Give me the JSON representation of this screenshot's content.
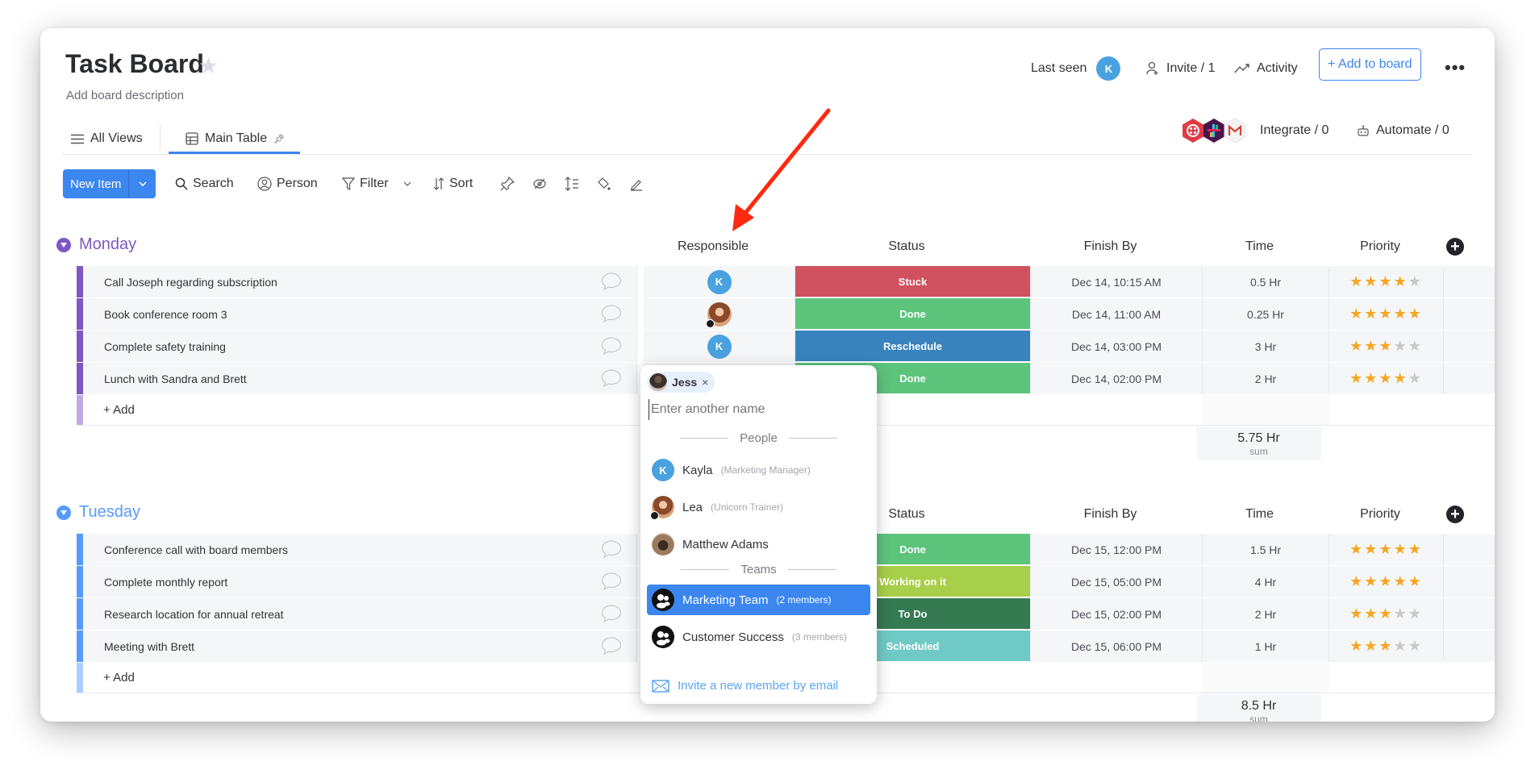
{
  "board": {
    "title": "Task Board",
    "description": "Add board description"
  },
  "header": {
    "last_seen_label": "Last seen",
    "last_seen_avatar": "K",
    "invite_label": "Invite / 1",
    "activity_label": "Activity",
    "add_to_board_label": "+ Add to board",
    "integrate_label": "Integrate / 0",
    "automate_label": "Automate / 0"
  },
  "tabs": [
    {
      "label": "All Views",
      "icon": "menu-icon"
    },
    {
      "label": "Main Table",
      "icon": "table-icon",
      "active": true
    }
  ],
  "toolbar": {
    "new_item_label": "New Item",
    "search_label": "Search",
    "person_label": "Person",
    "filter_label": "Filter",
    "sort_label": "Sort"
  },
  "columns": [
    "Responsible",
    "Status",
    "Finish By",
    "Time",
    "Priority"
  ],
  "groups": [
    {
      "name": "Monday",
      "color": "#7e57c2",
      "add_label": "+ Add",
      "sum_value": "5.75 Hr",
      "sum_label": "sum",
      "rows": [
        {
          "name": "Call Joseph regarding subscription",
          "responsible": "K",
          "status": "Stuck",
          "status_color": "#d0515f",
          "finish_by": "Dec 14, 10:15 AM",
          "time": "0.5 Hr",
          "priority": 4
        },
        {
          "name": "Book conference room 3",
          "responsible": "photo",
          "status": "Done",
          "status_color": "#5cc47b",
          "finish_by": "Dec 14, 11:00 AM",
          "time": "0.25 Hr",
          "priority": 5
        },
        {
          "name": "Complete safety training",
          "responsible": "K",
          "status": "Reschedule",
          "status_color": "#3883bd",
          "finish_by": "Dec 14, 03:00 PM",
          "time": "3 Hr",
          "priority": 3
        },
        {
          "name": "Lunch with Sandra and Brett",
          "responsible": "",
          "status": "Done",
          "status_color": "#5cc47b",
          "finish_by": "Dec 14, 02:00 PM",
          "time": "2 Hr",
          "priority": 4
        }
      ]
    },
    {
      "name": "Tuesday",
      "color": "#579bfc",
      "add_label": "+ Add",
      "sum_value": "8.5 Hr",
      "sum_label": "sum",
      "rows": [
        {
          "name": "Conference call with board members",
          "status": "Done",
          "status_color": "#5cc47b",
          "finish_by": "Dec 15, 12:00 PM",
          "time": "1.5 Hr",
          "priority": 5
        },
        {
          "name": "Complete monthly report",
          "status": "Working on it",
          "status_color": "#a8cf4a",
          "finish_by": "Dec 15, 05:00 PM",
          "time": "4 Hr",
          "priority": 5
        },
        {
          "name": "Research location for annual retreat",
          "status": "To Do",
          "status_color": "#367a52",
          "finish_by": "Dec 15, 02:00 PM",
          "time": "2 Hr",
          "priority": 3
        },
        {
          "name": "Meeting with Brett",
          "status": "Scheduled",
          "status_color": "#6fcac5",
          "finish_by": "Dec 15, 06:00 PM",
          "time": "1 Hr",
          "priority": 3
        }
      ]
    }
  ],
  "person_picker": {
    "selected_chip": "Jess",
    "input_placeholder": "Enter another name",
    "people_heading": "People",
    "people": [
      {
        "name": "Kayla",
        "title": "(Marketing Manager)",
        "avatar": "K"
      },
      {
        "name": "Lea",
        "title": "(Unicorn Trainer)",
        "avatar": "photo"
      },
      {
        "name": "Matthew Adams",
        "title": "",
        "avatar": "photo"
      }
    ],
    "teams_heading": "Teams",
    "teams": [
      {
        "name": "Marketing Team",
        "members": "(2 members)",
        "selected": true
      },
      {
        "name": "Customer Success",
        "members": "(3 members)",
        "selected": false
      }
    ],
    "invite_label": "Invite a new member by email"
  },
  "colors": {
    "accent": "#3b86ef",
    "annotation_arrow": "#ff2a0e",
    "star_on": "#f5a623",
    "star_off": "#c8c8c8"
  }
}
